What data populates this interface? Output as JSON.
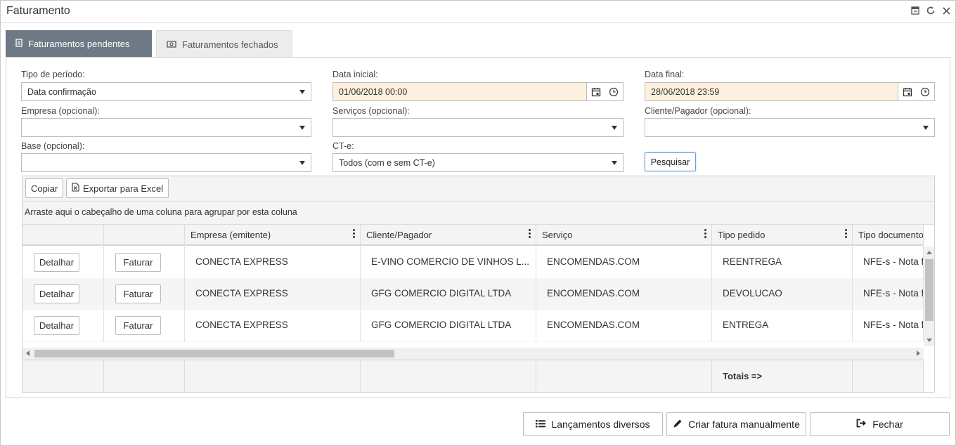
{
  "window": {
    "title": "Faturamento"
  },
  "tabs": [
    {
      "label": "Faturamentos pendentes"
    },
    {
      "label": "Faturamentos fechados"
    }
  ],
  "filters": {
    "tipo_periodo": {
      "label": "Tipo de período:",
      "value": "Data confirmação"
    },
    "data_inicial": {
      "label": "Data inicial:",
      "value": "01/06/2018 00:00"
    },
    "data_final": {
      "label": "Data final:",
      "value": "28/06/2018 23:59"
    },
    "empresa": {
      "label": "Empresa (opcional):",
      "value": ""
    },
    "servicos": {
      "label": "Serviços (opcional):",
      "value": ""
    },
    "cliente": {
      "label": "Cliente/Pagador (opcional):",
      "value": ""
    },
    "base": {
      "label": "Base (opcional):",
      "value": ""
    },
    "cte": {
      "label": "CT-e:",
      "value": "Todos (com e sem CT-e)"
    },
    "search_label": "Pesquisar"
  },
  "grid": {
    "copy_label": "Copiar",
    "export_label": "Exportar para Excel",
    "group_hint": "Arraste aqui o cabeçalho de uma coluna para agrupar por esta coluna",
    "columns": [
      "",
      "",
      "Empresa (emitente)",
      "Cliente/Pagador",
      "Serviço",
      "Tipo pedido",
      "Tipo documento"
    ],
    "detail_label": "Detalhar",
    "invoice_label": "Faturar",
    "rows": [
      {
        "empresa": "CONECTA EXPRESS",
        "cliente": "E-VINO COMERCIO DE VINHOS L...",
        "servico": "ENCOMENDAS.COM",
        "tipo_pedido": "REENTREGA",
        "tipo_documento": "NFE-s - Nota fi"
      },
      {
        "empresa": "CONECTA EXPRESS",
        "cliente": "GFG COMERCIO DIGITAL LTDA",
        "servico": "ENCOMENDAS.COM",
        "tipo_pedido": "DEVOLUCAO",
        "tipo_documento": "NFE-s - Nota fi"
      },
      {
        "empresa": "CONECTA EXPRESS",
        "cliente": "GFG COMERCIO DIGITAL LTDA",
        "servico": "ENCOMENDAS.COM",
        "tipo_pedido": "ENTREGA",
        "tipo_documento": "NFE-s - Nota fi"
      }
    ],
    "totals_label": "Totais =>"
  },
  "actions": {
    "lancamentos": "Lançamentos diversos",
    "criar_fatura": "Criar fatura manualmente",
    "fechar": "Fechar"
  }
}
